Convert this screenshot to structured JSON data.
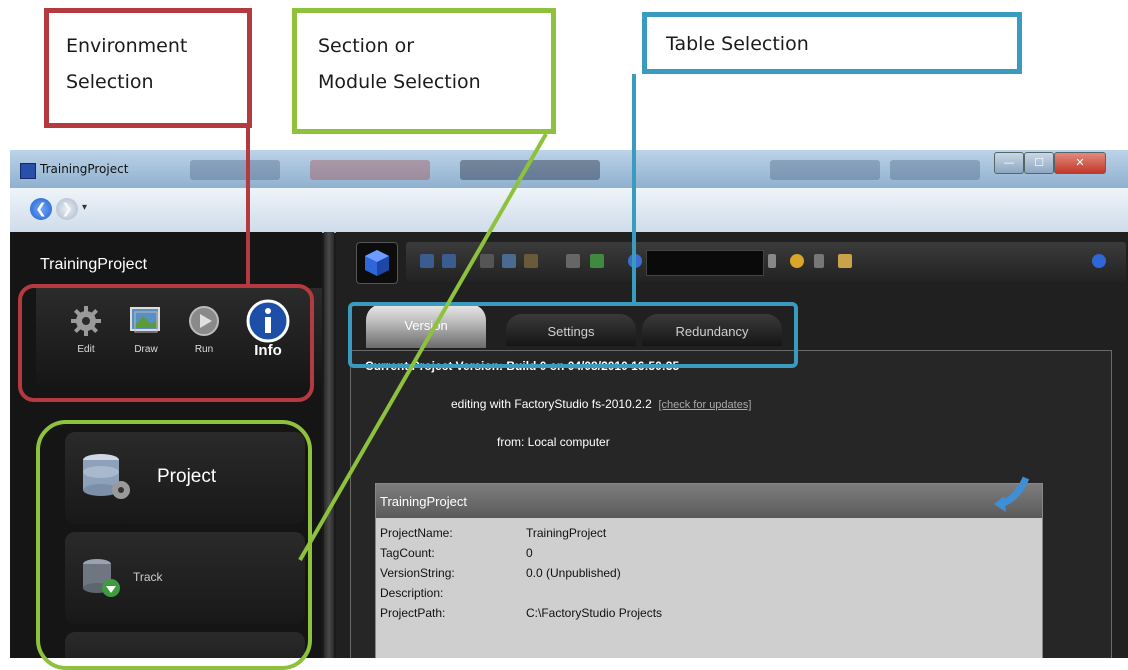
{
  "callouts": {
    "environment": [
      "Environment",
      "Selection"
    ],
    "section": [
      "Section or",
      "Module Selection"
    ],
    "table": [
      "Table Selection"
    ]
  },
  "colors": {
    "environment": "#b53a3f",
    "section": "#8ec23d",
    "table": "#3b9bbf"
  },
  "window": {
    "title": "TrainingProject",
    "controls": {
      "minimize": "—",
      "maximize": "☐",
      "close": "✕"
    }
  },
  "left_panel": {
    "project_name": "TrainingProject",
    "environments": [
      {
        "label": "Edit",
        "icon": "gear-icon"
      },
      {
        "label": "Draw",
        "icon": "picture-icon"
      },
      {
        "label": "Run",
        "icon": "play-icon"
      },
      {
        "label": "Info",
        "icon": "info-icon"
      }
    ],
    "modules": [
      {
        "label": "Project",
        "icon": "database-gear-icon"
      },
      {
        "label": "Track",
        "icon": "database-download-icon"
      }
    ]
  },
  "right_panel": {
    "tabs": [
      "Version",
      "Settings",
      "Redundancy"
    ],
    "active_tab": "Version",
    "version_line": "Current Project Version: Build 0 on 04/08/2010 16:50:35",
    "editing_line": "editing with FactoryStudio fs-2010.2.2",
    "check_updates": "[check for updates]",
    "from_line": "from: Local computer",
    "info_box": {
      "title": "TrainingProject",
      "properties": [
        {
          "key": "ProjectName:",
          "value": "TrainingProject"
        },
        {
          "key": "TagCount:",
          "value": "0"
        },
        {
          "key": "VersionString:",
          "value": "0.0 (Unpublished)"
        },
        {
          "key": "Description:",
          "value": ""
        },
        {
          "key": "ProjectPath:",
          "value": "C:\\FactoryStudio Projects"
        }
      ]
    }
  }
}
